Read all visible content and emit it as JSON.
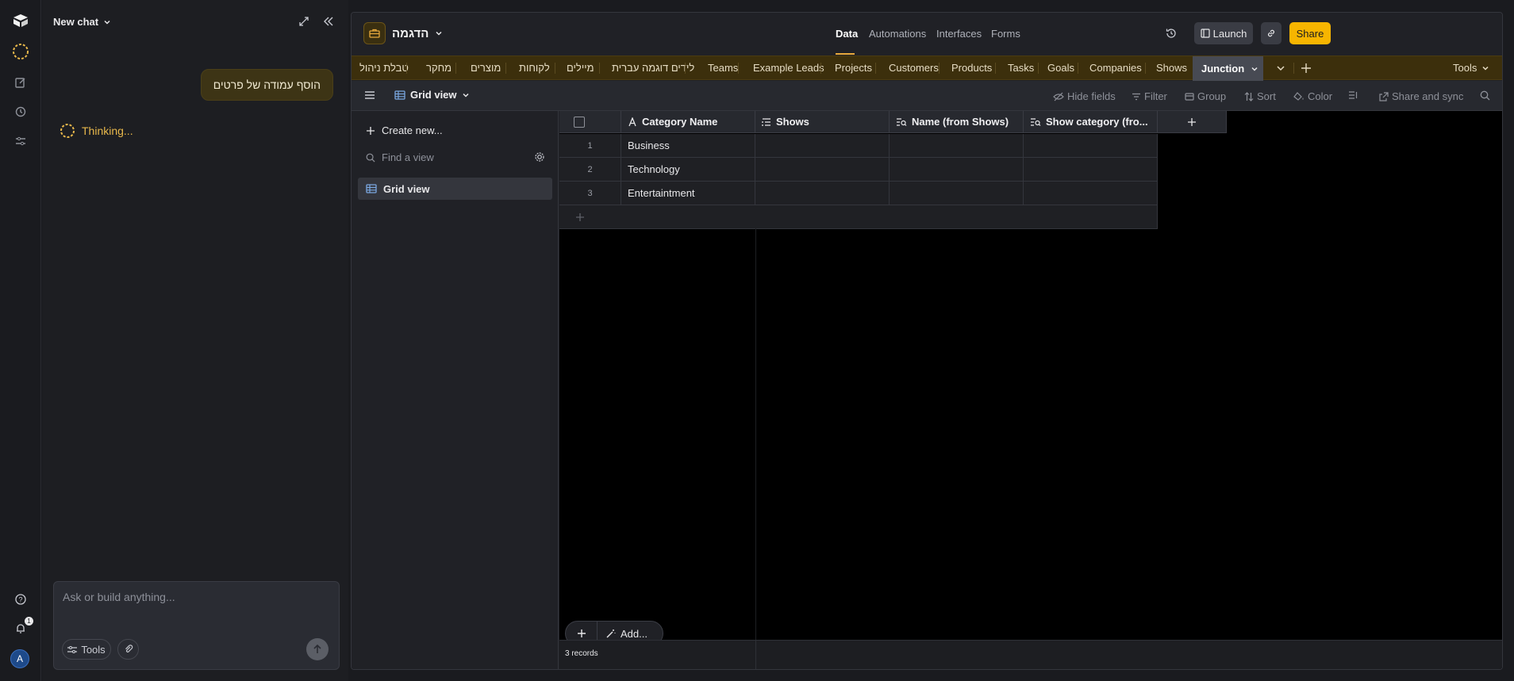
{
  "chat": {
    "title": "New chat",
    "user_message": "הוסף עמודה של פרטים",
    "thinking": "Thinking...",
    "placeholder": "Ask or build anything...",
    "tools_label": "Tools",
    "notification_count": "1",
    "avatar_initial": "A"
  },
  "base": {
    "name": "הדגמה",
    "nav": [
      "Data",
      "Automations",
      "Interfaces",
      "Forms"
    ],
    "launch_label": "Launch",
    "share_label": "Share"
  },
  "tabs": [
    "טבלת ניהול",
    "מחקר",
    "מוצרים",
    "לקוחות",
    "מיילים",
    "לידים דוגמה עברית",
    "Teams",
    "Example Leads",
    "Projects",
    "Customers",
    "Products",
    "Tasks",
    "Goals",
    "Companies",
    "Shows"
  ],
  "active_tab": "Junction",
  "tools_label": "Tools",
  "viewbar": {
    "view_name": "Grid view",
    "hide_fields": "Hide fields",
    "filter": "Filter",
    "group": "Group",
    "sort": "Sort",
    "color": "Color",
    "share_sync": "Share and sync"
  },
  "views_sidebar": {
    "create_new": "Create new...",
    "find_placeholder": "Find a view",
    "views": [
      "Grid view"
    ]
  },
  "grid": {
    "columns": [
      "Category Name",
      "Shows",
      "Name (from Shows)",
      "Show category (fro..."
    ],
    "rows": [
      {
        "num": "1",
        "name": "Business"
      },
      {
        "num": "2",
        "name": "Technology"
      },
      {
        "num": "3",
        "name": "Entertaintment"
      }
    ],
    "add_label": "Add...",
    "records": "3 records"
  },
  "colors": {
    "accent": "#f7b500",
    "tab_bar": "#3c2f0c",
    "active_tab": "#474a53"
  }
}
